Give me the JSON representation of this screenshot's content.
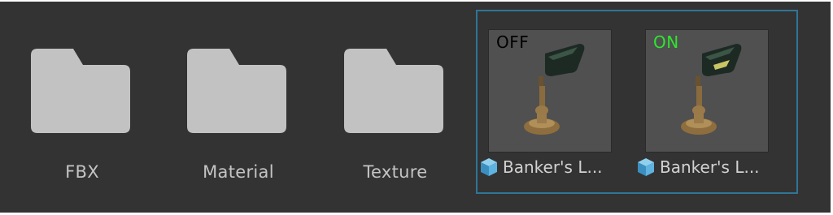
{
  "folders": [
    {
      "label": "FBX",
      "icon": "folder-icon"
    },
    {
      "label": "Material",
      "icon": "folder-icon"
    },
    {
      "label": "Texture",
      "icon": "folder-icon"
    }
  ],
  "prefabs": [
    {
      "label": "Banker's L...",
      "tag": "OFF",
      "tag_color": "#000000",
      "icon": "prefab-cube-icon"
    },
    {
      "label": "Banker's L...",
      "tag": "ON",
      "tag_color": "#2ee62e",
      "icon": "prefab-cube-icon"
    }
  ],
  "colors": {
    "background": "#333333",
    "folder": "#c2c2c2",
    "selection_border": "#2f7596",
    "thumbnail_bg": "#505050"
  }
}
